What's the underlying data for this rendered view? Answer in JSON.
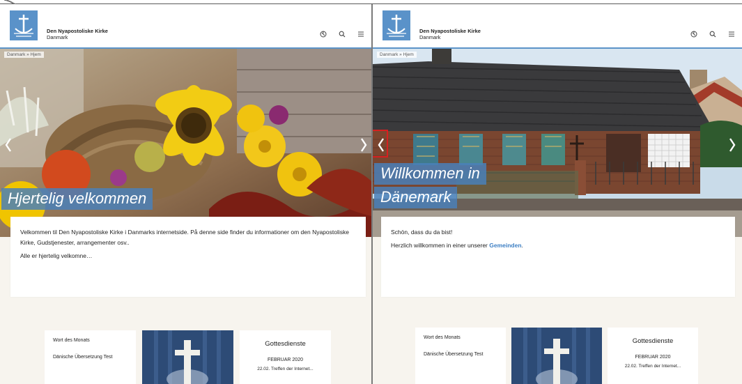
{
  "site": {
    "name": "Den Nyapostoliske Kirke",
    "region": "Danmark",
    "breadcrumb": "Danmark » Hjem"
  },
  "colors": {
    "brand_blue": "#5a92c9",
    "link_blue": "#3d7fc4",
    "highlight_red": "#d62020",
    "page_bg": "#f7f4ee"
  },
  "icons": [
    "logo-icon",
    "language-icon",
    "search-icon",
    "menu-icon",
    "chevron-left-icon",
    "chevron-right-icon"
  ],
  "left": {
    "hero_title": "Hjertelig velkommen",
    "intro_line1": "Velkommen til Den Nyapostoliske Kirke i Danmarks internetside. På denne side finder du informationer om den Nyapostoliske Kirke, Gudstjenester, arrangementer osv..",
    "intro_line2": "Alle er hjertelig velkomne…"
  },
  "right": {
    "hero_title_line1": "Willkommen in",
    "hero_title_line2": "Dänemark",
    "intro_line1": "Schön, dass du da bist!",
    "intro_line2_prefix": "Herzlich willkommen in einer unserer ",
    "intro_link": "Gemeinden",
    "intro_line2_suffix": "."
  },
  "tiles": {
    "word_title": "Wort des Monats",
    "word_subtitle": "Dänische Übersetzung Test",
    "services_title": "Gottesdienste",
    "services_month": "FEBRUAR 2020",
    "services_entry": "22.02. Treffen der Internet..."
  }
}
